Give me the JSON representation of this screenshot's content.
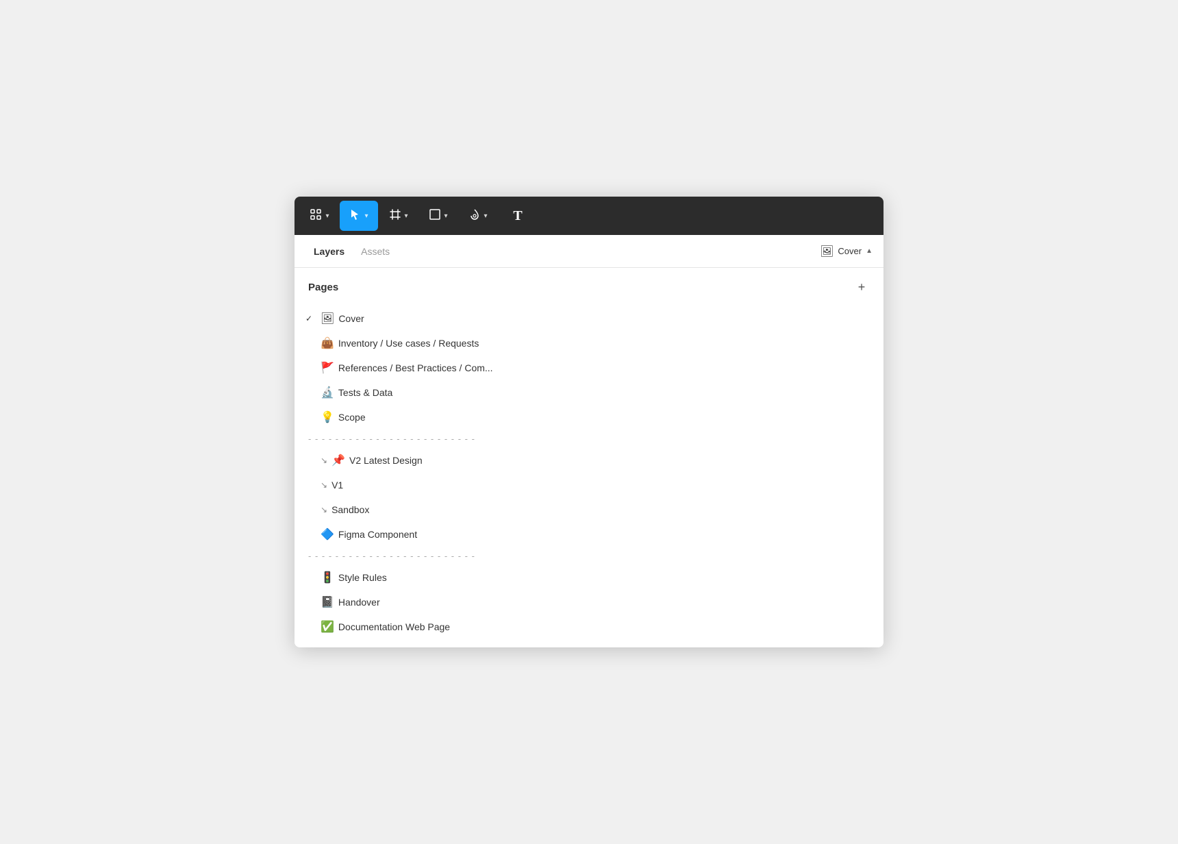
{
  "toolbar": {
    "tools": [
      {
        "id": "component",
        "label": "⊞",
        "symbol": "grid",
        "hasDropdown": true,
        "active": false
      },
      {
        "id": "select",
        "label": "↖",
        "symbol": "cursor",
        "hasDropdown": true,
        "active": true
      },
      {
        "id": "frame",
        "label": "#",
        "symbol": "frame",
        "hasDropdown": true,
        "active": false
      },
      {
        "id": "shape",
        "label": "□",
        "symbol": "shape",
        "hasDropdown": true,
        "active": false
      },
      {
        "id": "pen",
        "label": "✏",
        "symbol": "pen",
        "hasDropdown": true,
        "active": false
      },
      {
        "id": "text",
        "label": "T",
        "symbol": "text",
        "hasDropdown": false,
        "active": false
      }
    ]
  },
  "panel": {
    "tabs": [
      {
        "id": "layers",
        "label": "Layers",
        "active": true
      },
      {
        "id": "assets",
        "label": "Assets",
        "active": false
      }
    ],
    "current_page_emoji": "🖼",
    "current_page_name": "Cover",
    "current_page_chevron": "▲"
  },
  "pages_section": {
    "title": "Pages",
    "add_button_label": "+",
    "divider_text": "- - - - - - - - - - - - - - - - - - - - - - - - -",
    "pages": [
      {
        "id": "cover",
        "emoji": "🖼",
        "label": "Cover",
        "checked": true,
        "arrow": false,
        "pinned": false
      },
      {
        "id": "inventory",
        "emoji": "👜",
        "label": "Inventory / Use cases / Requests",
        "checked": false,
        "arrow": false,
        "pinned": false
      },
      {
        "id": "references",
        "emoji": "🚩",
        "label": "References  / Best Practices / Com...",
        "checked": false,
        "arrow": false,
        "pinned": false
      },
      {
        "id": "tests",
        "emoji": "🔬",
        "label": "Tests & Data",
        "checked": false,
        "arrow": false,
        "pinned": false
      },
      {
        "id": "scope",
        "emoji": "💡",
        "label": "Scope",
        "checked": false,
        "arrow": false,
        "pinned": false
      }
    ],
    "divider1": "- - - - - - - - - - - - - - - - - - - - - - - - -",
    "nested_pages": [
      {
        "id": "v2-latest",
        "emoji": "📌",
        "label": "V2  Latest Design",
        "checked": false,
        "arrow": true,
        "pinned": true
      },
      {
        "id": "v1",
        "emoji": "",
        "label": "V1",
        "checked": false,
        "arrow": true,
        "pinned": false
      },
      {
        "id": "sandbox",
        "emoji": "",
        "label": "Sandbox",
        "checked": false,
        "arrow": true,
        "pinned": false
      },
      {
        "id": "figma-component",
        "emoji": "🔷",
        "label": "Figma Component",
        "checked": false,
        "arrow": false,
        "pinned": false
      }
    ],
    "divider2": "- - - - - - - - - - - - - - - - - - - - - - - - -",
    "extra_pages": [
      {
        "id": "style-rules",
        "emoji": "🚦",
        "label": "Style Rules",
        "checked": false,
        "arrow": false
      },
      {
        "id": "handover",
        "emoji": "📓",
        "label": "Handover",
        "checked": false,
        "arrow": false
      },
      {
        "id": "documentation",
        "emoji": "✅",
        "label": "Documentation Web Page",
        "checked": false,
        "arrow": false
      }
    ]
  }
}
